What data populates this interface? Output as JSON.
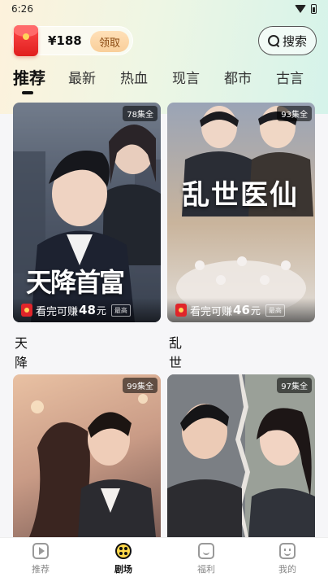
{
  "status_bar": {
    "time": "6:26"
  },
  "header": {
    "coupon_amount": "¥188",
    "claim_label": "领取",
    "search_label": "搜索"
  },
  "tabs": [
    {
      "label": "推荐",
      "active": true
    },
    {
      "label": "最新"
    },
    {
      "label": "热血"
    },
    {
      "label": "现言"
    },
    {
      "label": "都市"
    },
    {
      "label": "古言"
    }
  ],
  "cards": [
    {
      "title": "天降首富",
      "badge": "78集全",
      "poster_text": "天降首富",
      "earn_prefix": "看完可赚",
      "earn_amount": "48",
      "earn_unit": "元",
      "earn_tag": "最高"
    },
    {
      "title": "乱世医仙",
      "badge": "93集全",
      "poster_text": "乱世医仙",
      "earn_prefix": "看完可赚",
      "earn_amount": "46",
      "earn_unit": "元",
      "earn_tag": "最高"
    },
    {
      "title": "",
      "badge": "99集全"
    },
    {
      "title": "",
      "badge": "97集全"
    }
  ],
  "tabbar": [
    {
      "label": "推荐",
      "icon": "play-icon"
    },
    {
      "label": "剧场",
      "icon": "theater-reel-icon",
      "active": true
    },
    {
      "label": "福利",
      "icon": "gift-icon"
    },
    {
      "label": "我的",
      "icon": "profile-face-icon"
    }
  ]
}
